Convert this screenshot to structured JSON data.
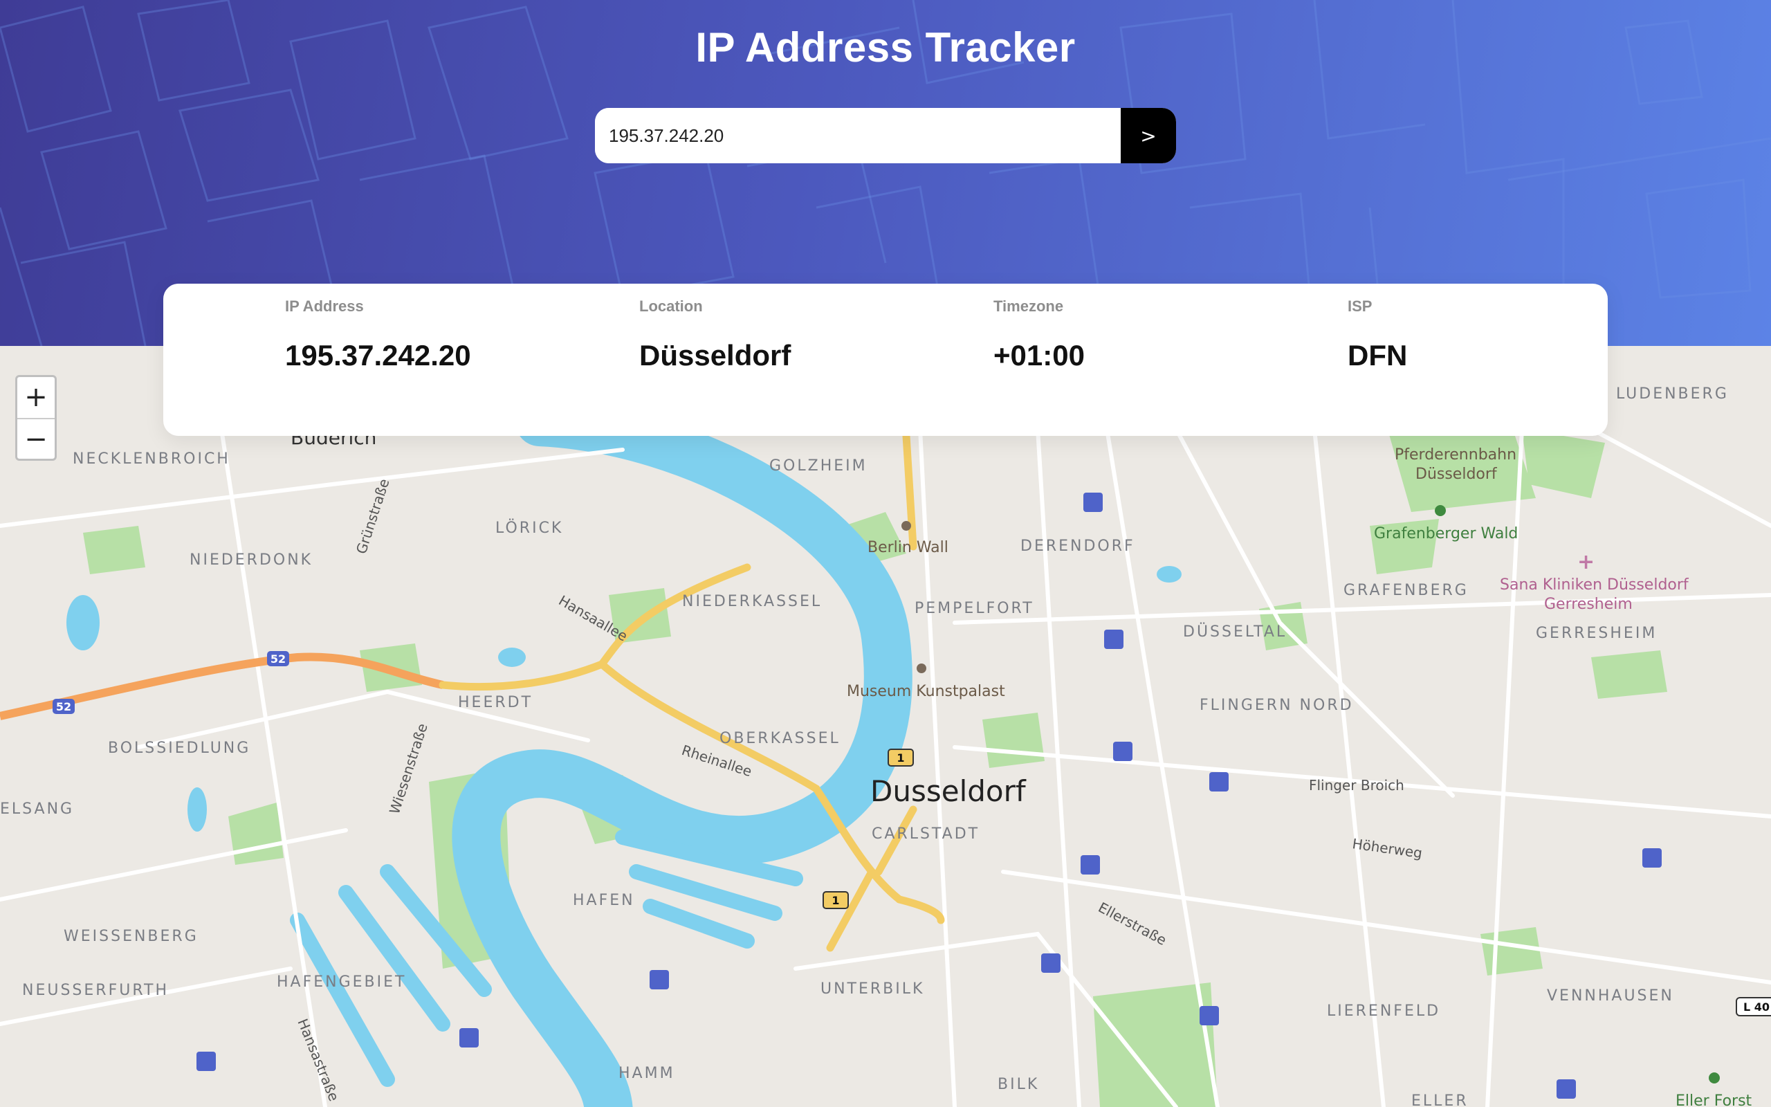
{
  "app": {
    "title": "IP Address Tracker"
  },
  "search": {
    "value": "195.37.242.20",
    "submit_label": ">"
  },
  "info": [
    {
      "label": "IP Address",
      "value": "195.37.242.20"
    },
    {
      "label": "Location",
      "value": "Düsseldorf"
    },
    {
      "label": "Timezone",
      "value": "+01:00"
    },
    {
      "label": "ISP",
      "value": "DFN"
    }
  ],
  "map": {
    "zoom_in_label": "+",
    "zoom_out_label": "−",
    "city_label": "Dusseldorf",
    "districts": [
      "Büderich",
      "NECKLENBROICH",
      "GOLZHEIM",
      "LÖRICK",
      "NIEDERDONK",
      "NIEDERKASSEL",
      "DERENDORF",
      "PEMPELFORT",
      "HEERDT",
      "BOLSSIEDLUNG",
      "OBERKASSEL",
      "DÜSSELTAL",
      "FLINGERN NORD",
      "GRAFENBERG",
      "GERRESHEIM",
      "LUDENBERG",
      "CARLSTADT",
      "HAFEN",
      "WEISSENBERG",
      "HAFENGEBIET",
      "NEUSSERFURTH",
      "UNTERBILK",
      "HAMM",
      "BILK",
      "LIERENFELD",
      "VENNHAUSEN",
      "ELSANG",
      "ELLER"
    ],
    "streets": [
      "Grünstraße",
      "Hansaallee",
      "Rheinallee",
      "Wiesenstraße",
      "Hansastraße",
      "Ellerstraße",
      "Höherweg",
      "Flinger Broich"
    ],
    "places": [
      "Berlin Wall",
      "Museum Kunstpalast",
      "Pferderennbahn",
      "Düsseldorf",
      "Grafenberger Wald",
      "Sana Kliniken Düsseldorf",
      "Gerresheim",
      "Eller Forst"
    ],
    "route_shields": [
      "52",
      "52",
      "1",
      "1",
      "L 40"
    ],
    "colors": {
      "land": "#ece9e4",
      "water": "#7fd0ee",
      "park": "#b7e0a6",
      "highway": "#f5a35c",
      "main_road": "#f3cc64",
      "transit_icon": "#4f63c9"
    }
  },
  "colors": {
    "header_gradient_start": "#3f3c96",
    "header_gradient_end": "#5c83e6",
    "button": "#000000",
    "card": "#ffffff"
  }
}
